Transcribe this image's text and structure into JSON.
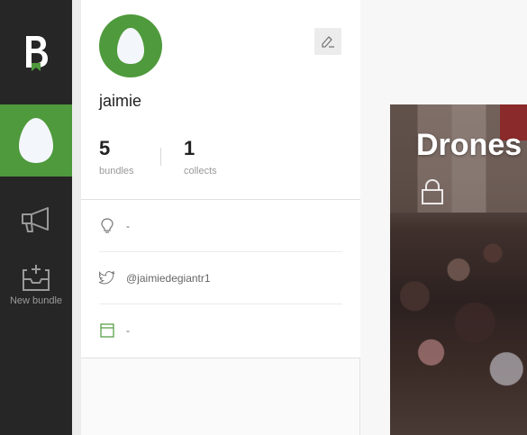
{
  "sidebar": {
    "logo_icon": "bundle-logo-icon",
    "items": [
      {
        "id": "profile",
        "icon": "egg-avatar-icon",
        "active": true
      },
      {
        "id": "announce",
        "icon": "megaphone-icon"
      },
      {
        "id": "new_bundle",
        "icon": "inbox-plus-icon",
        "label": "New bundle"
      }
    ]
  },
  "profile": {
    "username": "jaimie",
    "avatar_icon": "egg-avatar-icon",
    "edit_icon": "pencil-icon",
    "stats": [
      {
        "value": "5",
        "label": "bundles"
      },
      {
        "value": "1",
        "label": "collects"
      }
    ],
    "info": [
      {
        "icon": "lightbulb-icon",
        "text": "-"
      },
      {
        "icon": "twitter-icon",
        "text": "@jaimiedegiantr1"
      },
      {
        "icon": "browser-window-icon",
        "text": "-"
      }
    ]
  },
  "main": {
    "bundle_card": {
      "title": "Drones",
      "lock_icon": "lock-icon"
    }
  },
  "colors": {
    "sidebar_bg": "#262626",
    "accent_green": "#4e9a3c",
    "egg": "#f3f6fa"
  }
}
